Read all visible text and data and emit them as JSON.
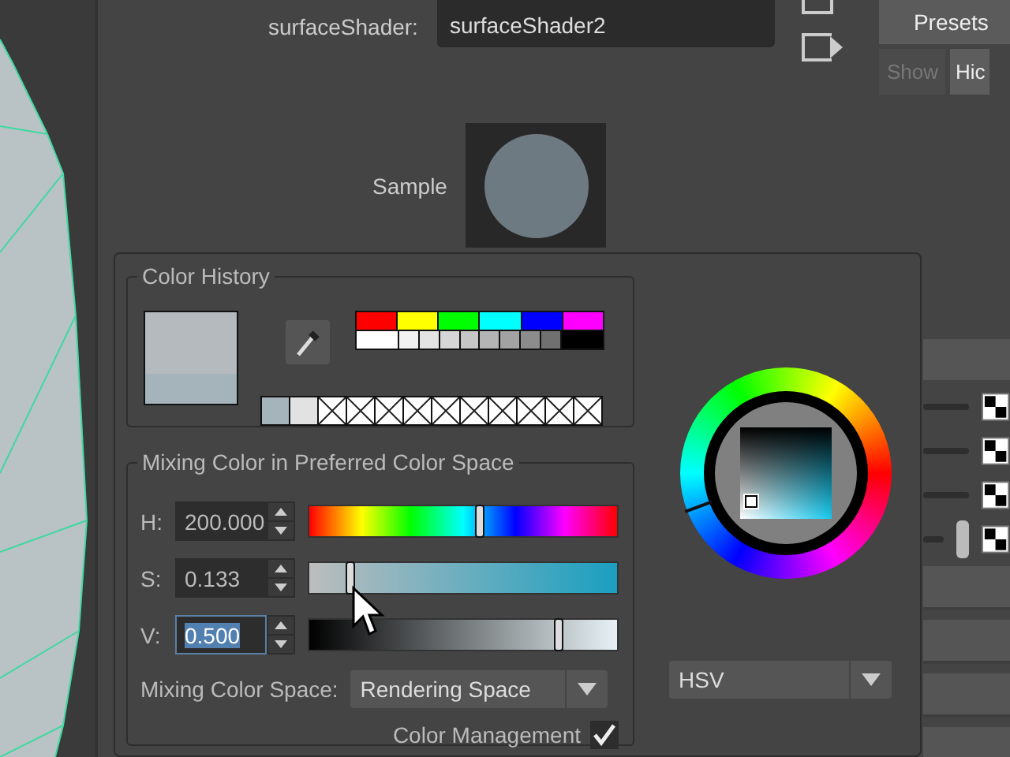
{
  "attribute_editor": {
    "shader_label": "surfaceShader:",
    "shader_name": "surfaceShader2",
    "presets_button": "Presets",
    "show_tabs": [
      {
        "label": "Show",
        "selected": false
      },
      {
        "label": "Hic",
        "selected": true
      }
    ],
    "sample_label": "Sample"
  },
  "color_chooser": {
    "history_title": "Color History",
    "palette": [
      {
        "color": "#ff0000"
      },
      {
        "color": "#ffff00"
      },
      {
        "color": "#00ff00"
      },
      {
        "color": "#00ffff"
      },
      {
        "color": "#0000ff"
      },
      {
        "color": "#ff00ff"
      },
      {
        "color": "#ffffff"
      },
      {
        "color": "#f2f2f2"
      },
      {
        "color": "#e4e4e4"
      },
      {
        "color": "#d6d6d6"
      },
      {
        "color": "#c6c6c6"
      },
      {
        "color": "#b4b4b4"
      },
      {
        "color": "#a2a2a2"
      },
      {
        "color": "#8c8c8c"
      },
      {
        "color": "#707070"
      },
      {
        "color": "#000000"
      }
    ],
    "history": [
      {
        "kind": "color",
        "color": "#a5b3bb"
      },
      {
        "kind": "color",
        "color": "#e2e2e2"
      },
      {
        "kind": "empty"
      },
      {
        "kind": "empty"
      },
      {
        "kind": "empty"
      },
      {
        "kind": "empty"
      },
      {
        "kind": "empty"
      },
      {
        "kind": "empty"
      },
      {
        "kind": "empty"
      },
      {
        "kind": "empty"
      },
      {
        "kind": "empty"
      },
      {
        "kind": "empty"
      }
    ],
    "mixing_title": "Mixing Color in Preferred Color Space",
    "channels": [
      {
        "kind": "hue",
        "label": "H:",
        "value": "200.000",
        "level": 0.556,
        "focused": false
      },
      {
        "kind": "saturation",
        "label": "S:",
        "value": "0.133",
        "level": 0.133,
        "focused": false
      },
      {
        "kind": "value",
        "label": "V:",
        "value": "0.500",
        "level": 0.81,
        "focused": true
      }
    ],
    "mixing_space_label": "Mixing Color Space:",
    "mixing_space_value": "Rendering Space",
    "color_management": {
      "label": "Color Management",
      "checked": true
    },
    "mode_value": "HSV"
  }
}
